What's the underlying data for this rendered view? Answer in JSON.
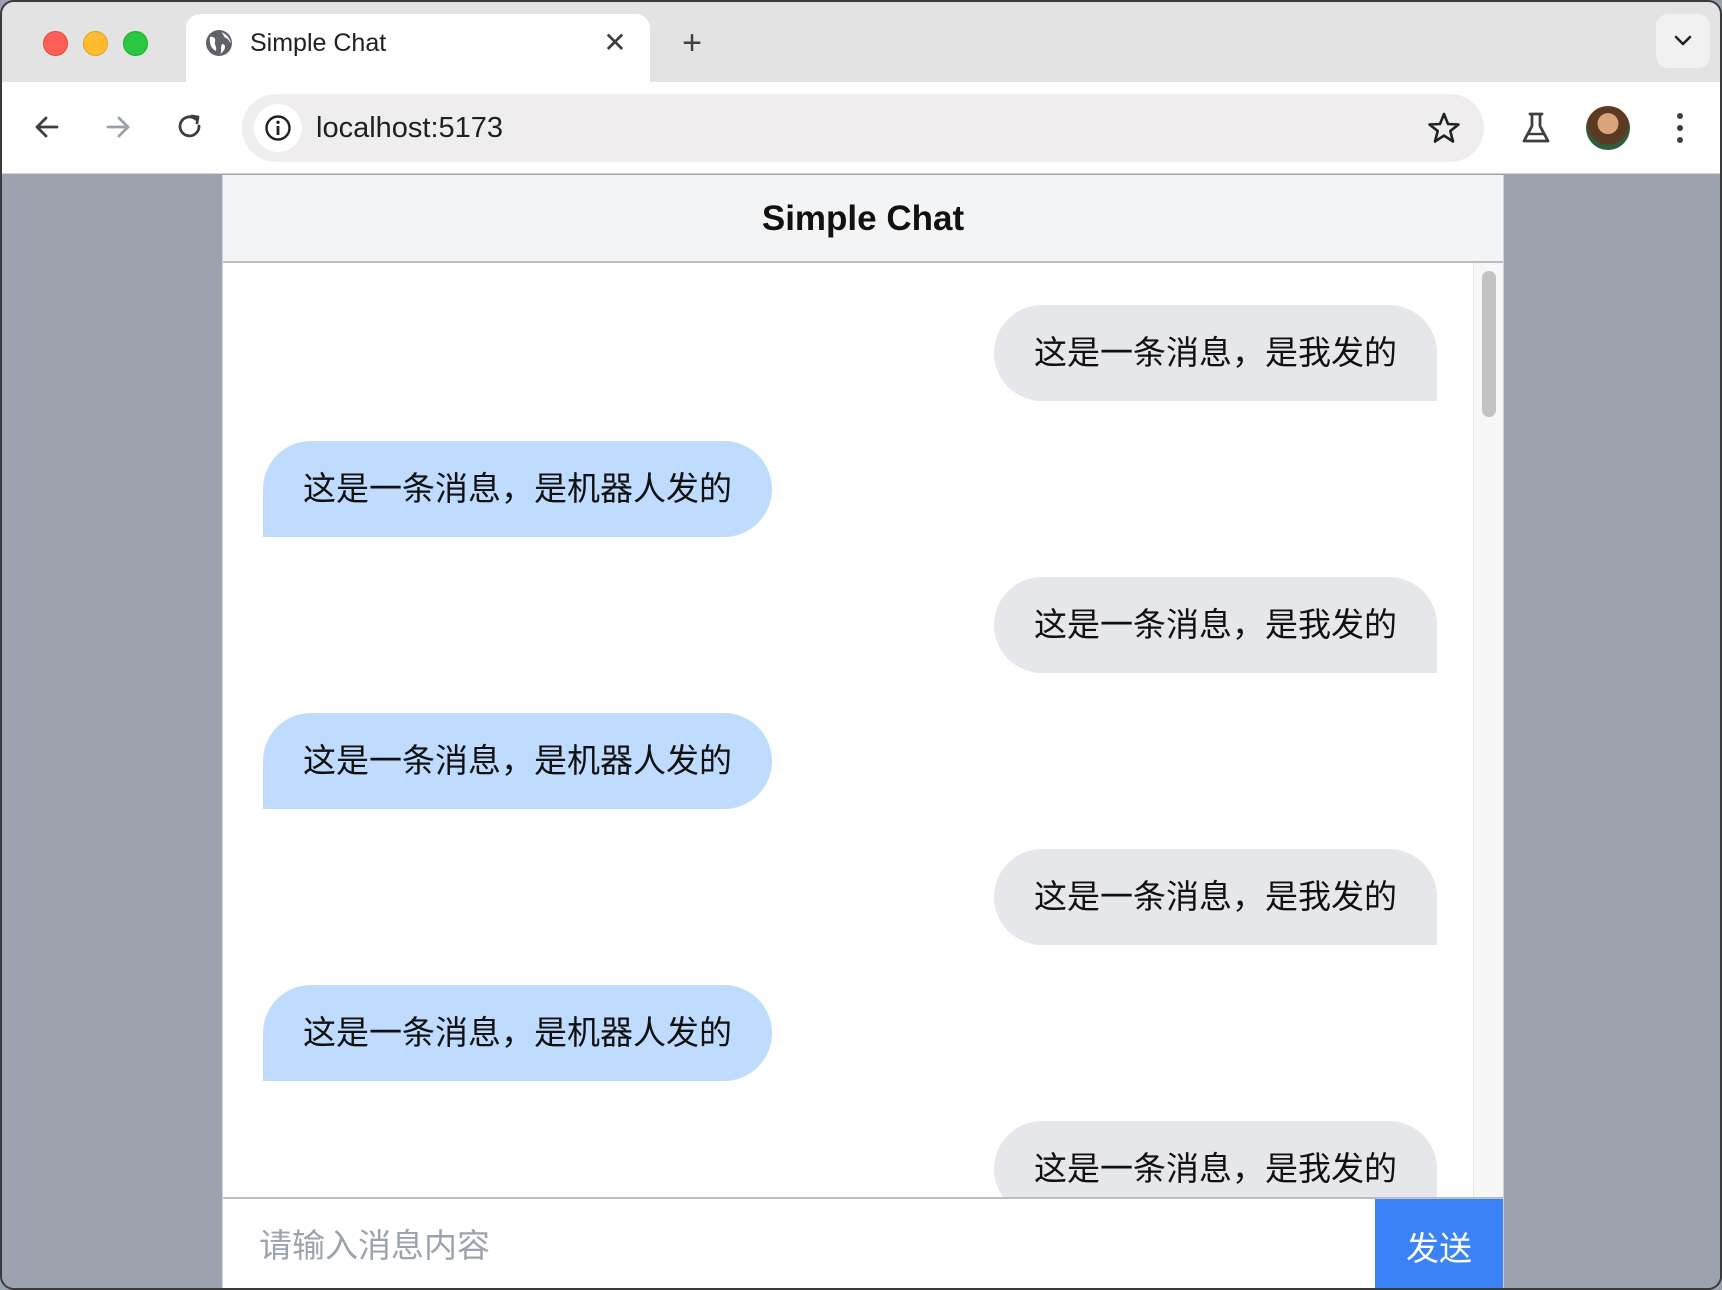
{
  "browser": {
    "tab_title": "Simple Chat",
    "new_tab_symbol": "+",
    "close_symbol": "✕",
    "url": "localhost:5173"
  },
  "chat": {
    "title": "Simple Chat",
    "messages": [
      {
        "sender": "me",
        "text": "这是一条消息，是我发的"
      },
      {
        "sender": "bot",
        "text": "这是一条消息，是机器人发的"
      },
      {
        "sender": "me",
        "text": "这是一条消息，是我发的"
      },
      {
        "sender": "bot",
        "text": "这是一条消息，是机器人发的"
      },
      {
        "sender": "me",
        "text": "这是一条消息，是我发的"
      },
      {
        "sender": "bot",
        "text": "这是一条消息，是机器人发的"
      },
      {
        "sender": "me",
        "text": "这是一条消息，是我发的"
      }
    ],
    "input_placeholder": "请输入消息内容",
    "send_label": "发送"
  },
  "colors": {
    "accent": "#3b82f6",
    "bot_bubble": "#bfdbfe",
    "user_bubble": "#e5e7eb",
    "page_bg": "#9ca3af"
  }
}
